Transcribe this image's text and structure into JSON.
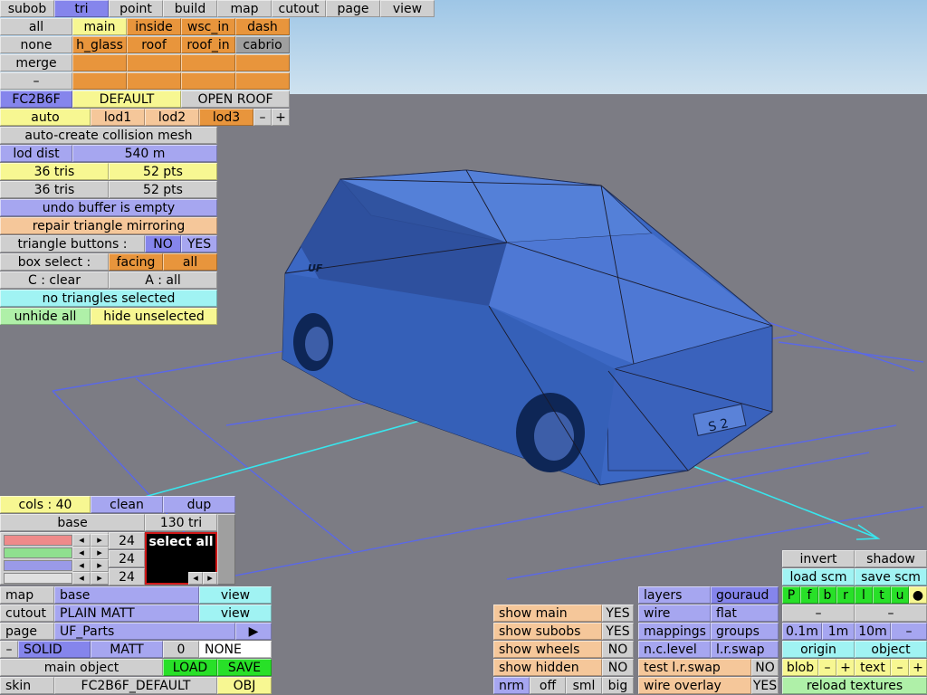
{
  "menu": [
    "subob",
    "tri",
    "point",
    "build",
    "map",
    "cutout",
    "page",
    "view"
  ],
  "subobjects": {
    "all": "all",
    "none": "none",
    "merge": "merge",
    "dash_btn": "–",
    "items": [
      "main",
      "inside",
      "wsc_in",
      "dash",
      "h_glass",
      "roof",
      "roof_in",
      "cabrio"
    ]
  },
  "config": {
    "id": "FC2B6F",
    "default": "DEFAULT",
    "open_roof": "OPEN ROOF"
  },
  "lod": {
    "auto": "auto",
    "lod1": "lod1",
    "lod2": "lod2",
    "lod3": "lod3",
    "minus": "–",
    "plus": "+",
    "auto_collision": "auto-create collision mesh",
    "dist_label": "lod dist",
    "dist_value": "540 m"
  },
  "stats": {
    "tris1": "36 tris",
    "pts1": "52 pts",
    "tris2": "36 tris",
    "pts2": "52 pts"
  },
  "tri_panel": {
    "undo": "undo buffer is empty",
    "repair": "repair triangle mirroring",
    "buttons_label": "triangle buttons :",
    "no": "NO",
    "yes": "YES",
    "box_select": "box select :",
    "facing": "facing",
    "all": "all",
    "clear": "C : clear",
    "select_all_key": "A : all",
    "no_sel": "no triangles selected",
    "unhide": "unhide all",
    "hide_unsel": "hide unselected"
  },
  "colours": {
    "cols": "cols : 40",
    "clean": "clean",
    "dup": "dup",
    "base": "base",
    "tri_count": "130 tri",
    "r": "24",
    "g": "24",
    "b": "24",
    "select_all": "select all",
    "map": "map",
    "map_val": "base",
    "cutout": "cutout",
    "cutout_val": "PLAIN MATT",
    "page": "page",
    "page_val": "UF_Parts",
    "view": "view",
    "minus": "–",
    "solid": "SOLID",
    "matt": "MATT",
    "zero": "0",
    "none": "NONE",
    "main_object": "main object",
    "load": "LOAD",
    "save": "SAVE",
    "skin": "skin",
    "skin_val": "FC2B6F_DEFAULT",
    "obj": "OBJ"
  },
  "show": {
    "main": "show main",
    "main_v": "YES",
    "subobs": "show subobs",
    "subobs_v": "YES",
    "wheels": "show wheels",
    "wheels_v": "NO",
    "hidden": "show hidden",
    "hidden_v": "NO",
    "nrm": "nrm",
    "off": "off",
    "sml": "sml",
    "big": "big"
  },
  "render": {
    "layers": "layers",
    "gouraud": "gouraud",
    "wire": "wire",
    "flat": "flat",
    "mappings": "mappings",
    "groups": "groups",
    "nc_level": "n.c.level",
    "lr_swap": "l.r.swap",
    "test_lr": "test l.r.swap",
    "test_lr_v": "NO",
    "wire_overlay": "wire overlay",
    "wire_overlay_v": "YES"
  },
  "tools": {
    "invert": "invert",
    "shadow": "shadow",
    "load_scm": "load scm",
    "save_scm": "save scm",
    "letters": [
      "P",
      "f",
      "b",
      "r",
      "l",
      "t",
      "u",
      "●"
    ],
    "dash": "–",
    "m01": "0.1m",
    "m1": "1m",
    "m10": "10m",
    "origin": "origin",
    "object": "object",
    "blob": "blob",
    "text": "text",
    "minus": "–",
    "plus": "+",
    "reload": "reload textures"
  },
  "car": {
    "plate": "S 2",
    "badge": "UF"
  },
  "colors": {
    "sky": "#b4d4ec",
    "floor": "#7c7c84",
    "car_body": "#3c68c4",
    "grid": "#5a68e8",
    "axis": "#38e6ee"
  }
}
